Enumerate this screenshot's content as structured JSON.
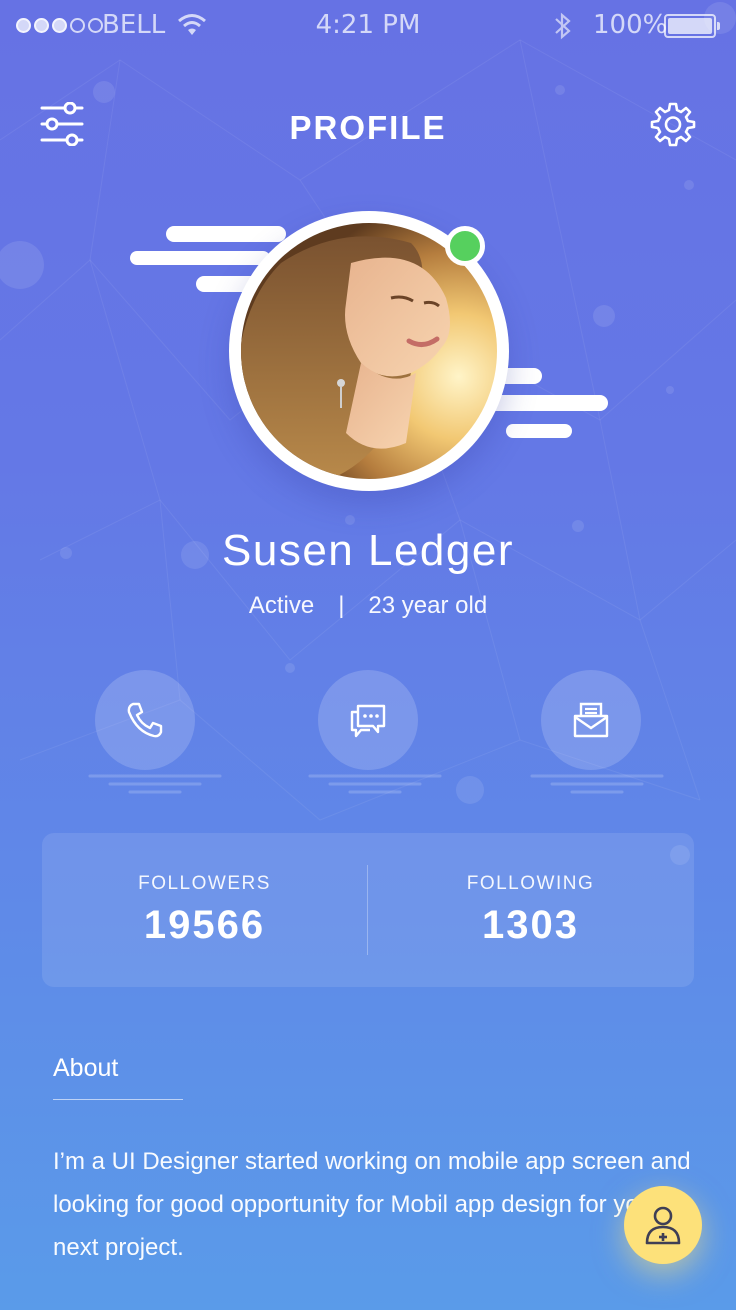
{
  "status_bar": {
    "carrier": "BELL",
    "time": "4:21 PM",
    "battery": "100%",
    "signal_bars": 3
  },
  "header": {
    "title": "PROFILE",
    "menu_icon": "filter-sliders-icon",
    "settings_icon": "gear-icon"
  },
  "profile": {
    "name": "Susen Ledger",
    "status": "Active",
    "separator": "|",
    "age": "23 year old",
    "online": true
  },
  "actions": [
    {
      "icon": "phone-icon"
    },
    {
      "icon": "chat-icon"
    },
    {
      "icon": "mail-icon"
    }
  ],
  "stats": {
    "followers_label": "FOLLOWERS",
    "followers_value": "19566",
    "following_label": "FOLLOWING",
    "following_value": "1303"
  },
  "about": {
    "heading": "About",
    "text": "I’m a UI Designer started working on mobile app screen and looking for good opportunity for Mobil app design for your next project."
  },
  "fab": {
    "icon": "add-user-icon"
  },
  "colors": {
    "bg_top": "#6672e4",
    "bg_bottom": "#5a9be9",
    "online": "#56d05e",
    "fab": "#fde17a"
  }
}
